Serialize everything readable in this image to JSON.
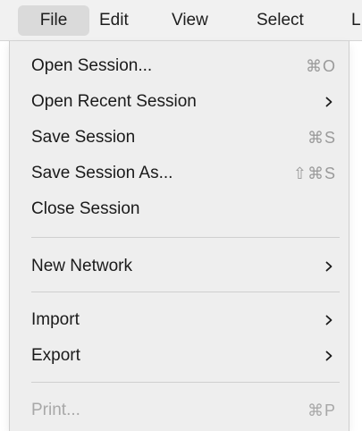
{
  "menubar": {
    "items": [
      "File",
      "Edit",
      "View",
      "Select",
      "L"
    ],
    "active": "File"
  },
  "menu": {
    "open_session": {
      "label": "Open Session...",
      "shortcut": "⌘O"
    },
    "open_recent_session": {
      "label": "Open Recent Session"
    },
    "save_session": {
      "label": "Save Session",
      "shortcut": "⌘S"
    },
    "save_session_as": {
      "label": "Save Session As...",
      "shortcut": "⇧⌘S"
    },
    "close_session": {
      "label": "Close Session"
    },
    "new_network": {
      "label": "New Network"
    },
    "import": {
      "label": "Import"
    },
    "export": {
      "label": "Export"
    },
    "print": {
      "label": "Print...",
      "shortcut": "⌘P",
      "disabled": true
    }
  },
  "colors": {
    "menubar_bg": "#f1f1f1",
    "active_item_bg": "#dadada",
    "menu_bg": "#eeeeee",
    "separator": "#cfcfcf",
    "text": "#1a1a1a",
    "shortcut_text": "#9a9a9a",
    "disabled_text": "#a8a8a8"
  },
  "icons": {
    "submenu_indicator": "chevron-right-icon"
  }
}
